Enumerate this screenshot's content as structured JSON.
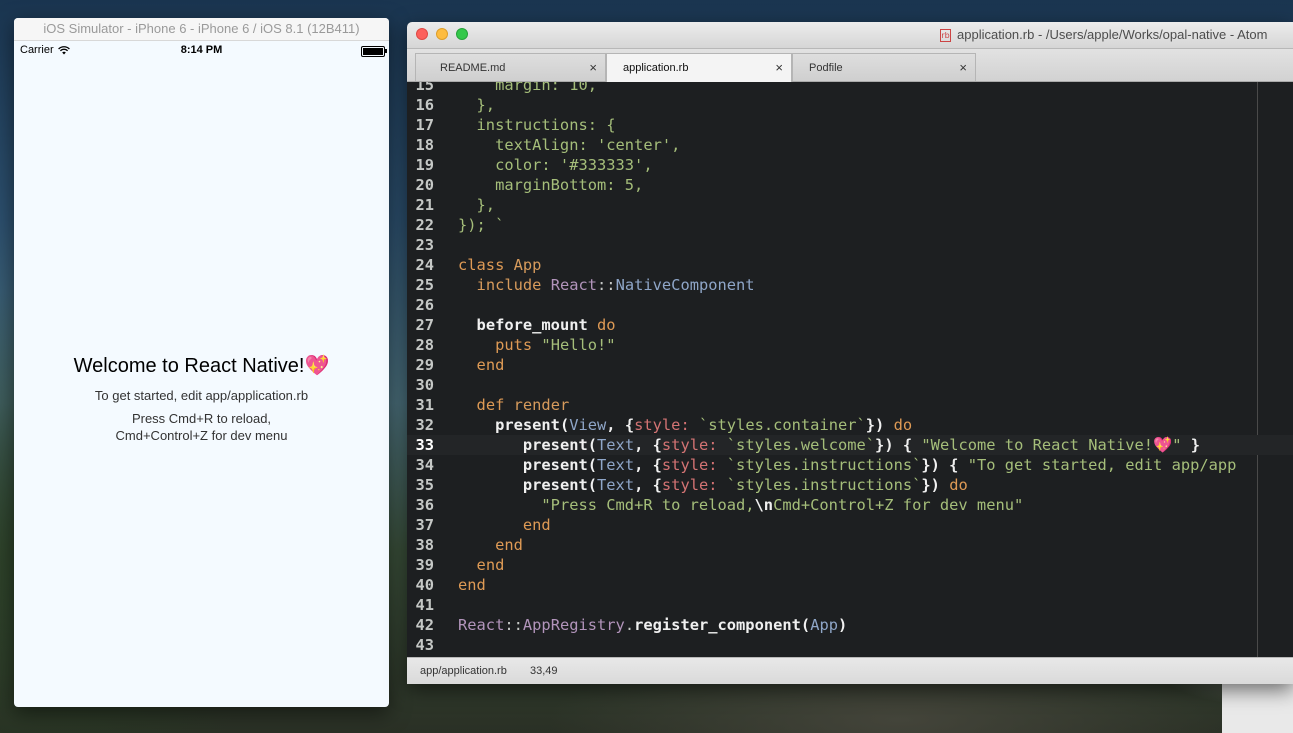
{
  "simulator": {
    "title": "iOS Simulator - iPhone 6 - iPhone 6 / iOS 8.1 (12B411)",
    "carrier": "Carrier",
    "time": "8:14 PM",
    "welcome": "Welcome to React Native!💖",
    "instructions_1": "To get started, edit app/application.rb",
    "instructions_2": "Press Cmd+R to reload,\nCmd+Control+Z for dev menu"
  },
  "atom": {
    "title": "application.rb - /Users/apple/Works/opal-native - Atom",
    "file_icon": "rb",
    "tabs": [
      {
        "label": "README.md",
        "close": "×"
      },
      {
        "label": "application.rb",
        "close": "×"
      },
      {
        "label": "Podfile",
        "close": "×"
      }
    ],
    "status": {
      "path": "app/application.rb",
      "cursor": "33,49"
    },
    "code": [
      {
        "n": "15",
        "t": [
          [
            "    margin: 10,",
            "str"
          ]
        ]
      },
      {
        "n": "16",
        "t": [
          [
            "  },",
            "str"
          ]
        ]
      },
      {
        "n": "17",
        "t": [
          [
            "  instructions: {",
            "str"
          ]
        ]
      },
      {
        "n": "18",
        "t": [
          [
            "    textAlign: 'center',",
            "str"
          ]
        ]
      },
      {
        "n": "19",
        "t": [
          [
            "    color: '#333333',",
            "str"
          ]
        ]
      },
      {
        "n": "20",
        "t": [
          [
            "    marginBottom: 5,",
            "str"
          ]
        ]
      },
      {
        "n": "21",
        "t": [
          [
            "  },",
            "str"
          ]
        ]
      },
      {
        "n": "22",
        "t": [
          [
            "});",
            "str"
          ],
          [
            " `",
            "str"
          ]
        ]
      },
      {
        "n": "23",
        "t": []
      },
      {
        "n": "24",
        "t": [
          [
            "class ",
            "kw"
          ],
          [
            "App",
            "def"
          ]
        ]
      },
      {
        "n": "25",
        "t": [
          [
            "  ",
            "plain"
          ],
          [
            "include ",
            "def"
          ],
          [
            "React",
            "mod"
          ],
          [
            "::",
            "plain"
          ],
          [
            "NativeComponent",
            "const"
          ]
        ]
      },
      {
        "n": "26",
        "t": []
      },
      {
        "n": "27",
        "t": [
          [
            "  ",
            "plain"
          ],
          [
            "before_mount ",
            "bold"
          ],
          [
            "do",
            "kw"
          ]
        ]
      },
      {
        "n": "28",
        "t": [
          [
            "    ",
            "plain"
          ],
          [
            "puts ",
            "kw"
          ],
          [
            "\"Hello!\"",
            "str"
          ]
        ]
      },
      {
        "n": "29",
        "t": [
          [
            "  ",
            "plain"
          ],
          [
            "end",
            "kw"
          ]
        ]
      },
      {
        "n": "30",
        "t": []
      },
      {
        "n": "31",
        "t": [
          [
            "  ",
            "plain"
          ],
          [
            "def ",
            "kw"
          ],
          [
            "render",
            "def"
          ]
        ]
      },
      {
        "n": "32",
        "t": [
          [
            "    ",
            "plain"
          ],
          [
            "present(",
            "bold"
          ],
          [
            "View",
            "const"
          ],
          [
            ", {",
            "bold"
          ],
          [
            "style:",
            "sym"
          ],
          [
            " `styles.container`",
            "str"
          ],
          [
            "}) ",
            "bold"
          ],
          [
            "do",
            "kw"
          ]
        ]
      },
      {
        "n": "33",
        "cur": true,
        "t": [
          [
            "       ",
            "plain"
          ],
          [
            "present(",
            "bold"
          ],
          [
            "Text",
            "const"
          ],
          [
            ", {",
            "bold"
          ],
          [
            "style:",
            "sym"
          ],
          [
            " `styles.welcome`",
            "str"
          ],
          [
            "}) ",
            "bold"
          ],
          [
            "{ ",
            "bold"
          ],
          [
            "\"Welcome to React Native!💖\"",
            "str"
          ],
          [
            " }",
            "bold"
          ]
        ]
      },
      {
        "n": "34",
        "t": [
          [
            "       ",
            "plain"
          ],
          [
            "present(",
            "bold"
          ],
          [
            "Text",
            "const"
          ],
          [
            ", {",
            "bold"
          ],
          [
            "style:",
            "sym"
          ],
          [
            " `styles.instructions`",
            "str"
          ],
          [
            "}) { ",
            "bold"
          ],
          [
            "\"To get started, edit app/app",
            "str"
          ]
        ]
      },
      {
        "n": "35",
        "t": [
          [
            "       ",
            "plain"
          ],
          [
            "present(",
            "bold"
          ],
          [
            "Text",
            "const"
          ],
          [
            ", {",
            "bold"
          ],
          [
            "style:",
            "sym"
          ],
          [
            " `styles.instructions`",
            "str"
          ],
          [
            "}) ",
            "bold"
          ],
          [
            "do",
            "kw"
          ]
        ]
      },
      {
        "n": "36",
        "t": [
          [
            "         ",
            "plain"
          ],
          [
            "\"Press Cmd+R to reload,",
            "str"
          ],
          [
            "\\n",
            "bold"
          ],
          [
            "Cmd+Control+Z for dev menu\"",
            "str"
          ]
        ]
      },
      {
        "n": "37",
        "t": [
          [
            "       ",
            "plain"
          ],
          [
            "end",
            "kw"
          ]
        ]
      },
      {
        "n": "38",
        "t": [
          [
            "    ",
            "plain"
          ],
          [
            "end",
            "kw"
          ]
        ]
      },
      {
        "n": "39",
        "t": [
          [
            "  ",
            "plain"
          ],
          [
            "end",
            "kw"
          ]
        ]
      },
      {
        "n": "40",
        "t": [
          [
            "end",
            "kw"
          ]
        ]
      },
      {
        "n": "41",
        "t": []
      },
      {
        "n": "42",
        "t": [
          [
            "React",
            "mod"
          ],
          [
            "::",
            "plain"
          ],
          [
            "AppRegistry",
            "mod"
          ],
          [
            ".",
            "plain"
          ],
          [
            "register_component",
            "bold"
          ],
          [
            "(",
            "bold"
          ],
          [
            "App",
            "const"
          ],
          [
            ")",
            "bold"
          ]
        ]
      },
      {
        "n": "43",
        "t": []
      }
    ]
  }
}
